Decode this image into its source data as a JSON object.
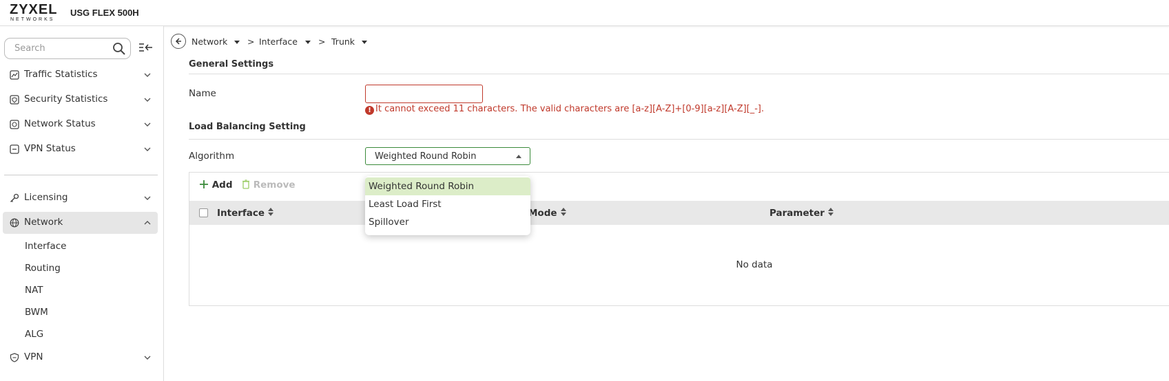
{
  "header": {
    "brand": "ZYXEL",
    "brand_sub": "NETWORKS",
    "model": "USG FLEX 500H"
  },
  "sidebar": {
    "search_placeholder": "Search",
    "items": [
      {
        "label": "Traffic Statistics",
        "icon": "chart-icon",
        "expanded": false
      },
      {
        "label": "Security Statistics",
        "icon": "shield-chart-icon",
        "expanded": false
      },
      {
        "label": "Network Status",
        "icon": "network-status-icon",
        "expanded": false
      },
      {
        "label": "VPN Status",
        "icon": "vpn-status-icon",
        "expanded": false
      },
      {
        "label": "Licensing",
        "icon": "key-icon",
        "expanded": false
      },
      {
        "label": "Network",
        "icon": "globe-icon",
        "expanded": true
      },
      {
        "label": "VPN",
        "icon": "shield-icon",
        "expanded": false
      }
    ],
    "network_children": [
      "Interface",
      "Routing",
      "NAT",
      "BWM",
      "ALG"
    ]
  },
  "breadcrumb": [
    "Network",
    "Interface",
    "Trunk"
  ],
  "general": {
    "title": "General Settings",
    "name_label": "Name",
    "name_value": "",
    "name_error": "It cannot exceed 11 characters. The valid characters are [a-z][A-Z]+[0-9][a-z][A-Z][_-]."
  },
  "load_balancing": {
    "title": "Load Balancing Setting",
    "algorithm_label": "Algorithm",
    "algorithm_value": "Weighted Round Robin",
    "algorithm_options": [
      "Weighted Round Robin",
      "Least Load First",
      "Spillover"
    ]
  },
  "table": {
    "add_label": "Add",
    "remove_label": "Remove",
    "columns": [
      "Interface",
      "Mode",
      "Parameter"
    ],
    "empty_text": "No data"
  },
  "colors": {
    "error": "#c0392b",
    "accent_green": "#3a8a3a",
    "selected_option": "#dcedc8"
  }
}
